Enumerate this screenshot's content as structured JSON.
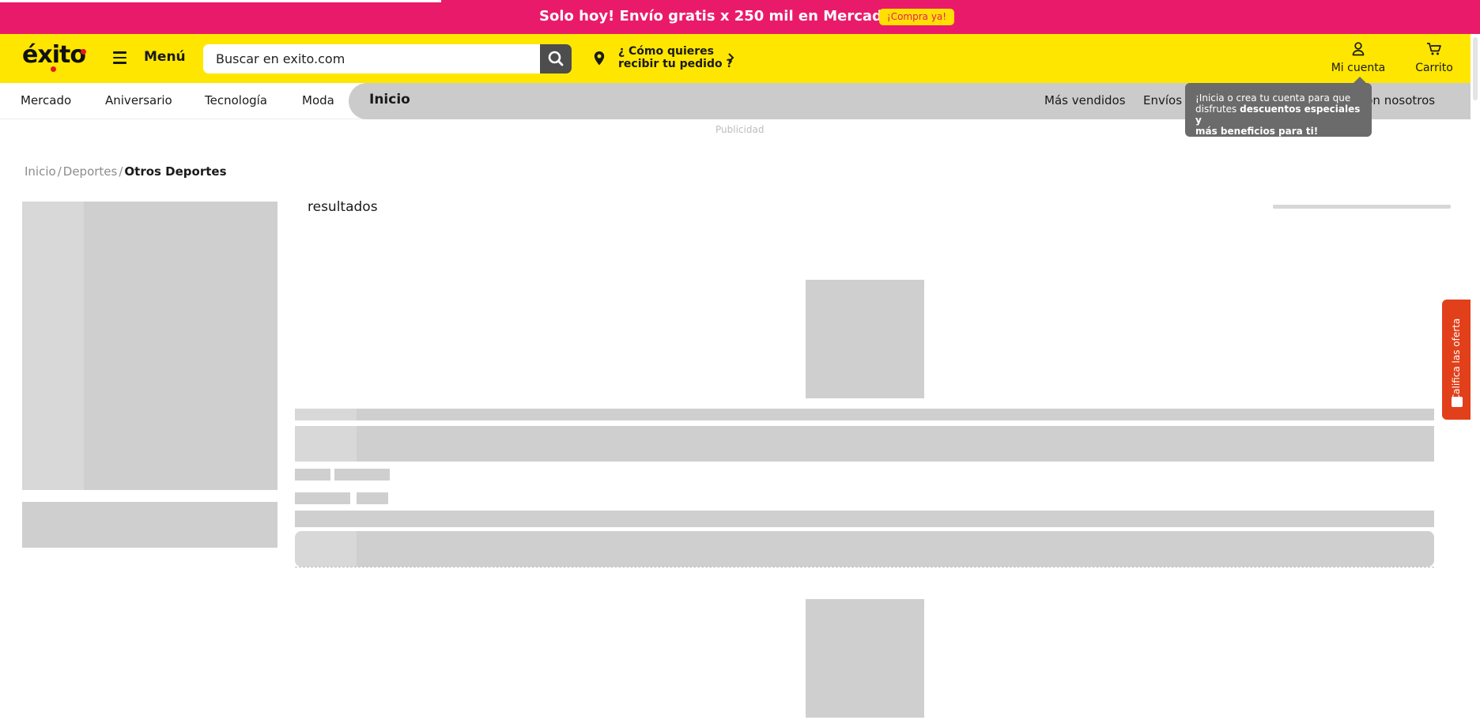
{
  "promo": {
    "text": "Solo hoy! Envío gratis x 250 mil en Mercado",
    "emoji": "🛒",
    "cta": "¡Compra ya!"
  },
  "header": {
    "logo": "éxito",
    "menu_label": "Menú",
    "search_placeholder": "Buscar en exito.com",
    "delivery_line1": "¿ Cómo quieres",
    "delivery_line2": "recibir tu pedido ?",
    "account_label": "Mi cuenta",
    "cart_label": "Carrito"
  },
  "nav": {
    "left_items": [
      "Mercado",
      "Aniversario",
      "Tecnología",
      "Moda"
    ],
    "active": "Inicio",
    "right_items": [
      "Más vendidos",
      "Envíos 2",
      "e con nosotros"
    ]
  },
  "ad_label": "Publicidad",
  "tooltip": {
    "line1": "¡Inicia o crea tu cuenta para que",
    "line2_plain": "disfrutes ",
    "line2_bold": "descuentos especiales y",
    "line3_bold": "más beneficios para ti!"
  },
  "breadcrumb": {
    "items": [
      "Inicio",
      "Deportes"
    ],
    "current": "Otros Deportes",
    "separator": "/"
  },
  "results_label": "resultados",
  "rate_tab": "Califica las oferta",
  "colors": {
    "promo_bg": "#ea1a6b",
    "header_bg": "#ffe600",
    "skeleton": "#cfcfcf",
    "rate_tab": "#e1401b"
  }
}
